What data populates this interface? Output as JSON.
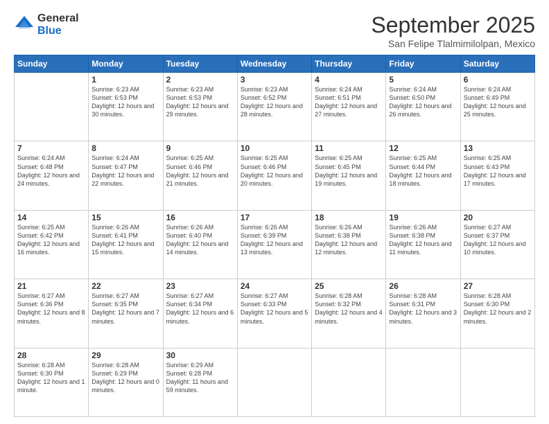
{
  "logo": {
    "general": "General",
    "blue": "Blue"
  },
  "header": {
    "month": "September 2025",
    "location": "San Felipe Tlalmimilolpan, Mexico"
  },
  "weekdays": [
    "Sunday",
    "Monday",
    "Tuesday",
    "Wednesday",
    "Thursday",
    "Friday",
    "Saturday"
  ],
  "weeks": [
    [
      {
        "day": "",
        "sunrise": "",
        "sunset": "",
        "daylight": ""
      },
      {
        "day": "1",
        "sunrise": "Sunrise: 6:23 AM",
        "sunset": "Sunset: 6:53 PM",
        "daylight": "Daylight: 12 hours and 30 minutes."
      },
      {
        "day": "2",
        "sunrise": "Sunrise: 6:23 AM",
        "sunset": "Sunset: 6:53 PM",
        "daylight": "Daylight: 12 hours and 29 minutes."
      },
      {
        "day": "3",
        "sunrise": "Sunrise: 6:23 AM",
        "sunset": "Sunset: 6:52 PM",
        "daylight": "Daylight: 12 hours and 28 minutes."
      },
      {
        "day": "4",
        "sunrise": "Sunrise: 6:24 AM",
        "sunset": "Sunset: 6:51 PM",
        "daylight": "Daylight: 12 hours and 27 minutes."
      },
      {
        "day": "5",
        "sunrise": "Sunrise: 6:24 AM",
        "sunset": "Sunset: 6:50 PM",
        "daylight": "Daylight: 12 hours and 26 minutes."
      },
      {
        "day": "6",
        "sunrise": "Sunrise: 6:24 AM",
        "sunset": "Sunset: 6:49 PM",
        "daylight": "Daylight: 12 hours and 25 minutes."
      }
    ],
    [
      {
        "day": "7",
        "sunrise": "Sunrise: 6:24 AM",
        "sunset": "Sunset: 6:48 PM",
        "daylight": "Daylight: 12 hours and 24 minutes."
      },
      {
        "day": "8",
        "sunrise": "Sunrise: 6:24 AM",
        "sunset": "Sunset: 6:47 PM",
        "daylight": "Daylight: 12 hours and 22 minutes."
      },
      {
        "day": "9",
        "sunrise": "Sunrise: 6:25 AM",
        "sunset": "Sunset: 6:46 PM",
        "daylight": "Daylight: 12 hours and 21 minutes."
      },
      {
        "day": "10",
        "sunrise": "Sunrise: 6:25 AM",
        "sunset": "Sunset: 6:46 PM",
        "daylight": "Daylight: 12 hours and 20 minutes."
      },
      {
        "day": "11",
        "sunrise": "Sunrise: 6:25 AM",
        "sunset": "Sunset: 6:45 PM",
        "daylight": "Daylight: 12 hours and 19 minutes."
      },
      {
        "day": "12",
        "sunrise": "Sunrise: 6:25 AM",
        "sunset": "Sunset: 6:44 PM",
        "daylight": "Daylight: 12 hours and 18 minutes."
      },
      {
        "day": "13",
        "sunrise": "Sunrise: 6:25 AM",
        "sunset": "Sunset: 6:43 PM",
        "daylight": "Daylight: 12 hours and 17 minutes."
      }
    ],
    [
      {
        "day": "14",
        "sunrise": "Sunrise: 6:25 AM",
        "sunset": "Sunset: 6:42 PM",
        "daylight": "Daylight: 12 hours and 16 minutes."
      },
      {
        "day": "15",
        "sunrise": "Sunrise: 6:26 AM",
        "sunset": "Sunset: 6:41 PM",
        "daylight": "Daylight: 12 hours and 15 minutes."
      },
      {
        "day": "16",
        "sunrise": "Sunrise: 6:26 AM",
        "sunset": "Sunset: 6:40 PM",
        "daylight": "Daylight: 12 hours and 14 minutes."
      },
      {
        "day": "17",
        "sunrise": "Sunrise: 6:26 AM",
        "sunset": "Sunset: 6:39 PM",
        "daylight": "Daylight: 12 hours and 13 minutes."
      },
      {
        "day": "18",
        "sunrise": "Sunrise: 6:26 AM",
        "sunset": "Sunset: 6:38 PM",
        "daylight": "Daylight: 12 hours and 12 minutes."
      },
      {
        "day": "19",
        "sunrise": "Sunrise: 6:26 AM",
        "sunset": "Sunset: 6:38 PM",
        "daylight": "Daylight: 12 hours and 11 minutes."
      },
      {
        "day": "20",
        "sunrise": "Sunrise: 6:27 AM",
        "sunset": "Sunset: 6:37 PM",
        "daylight": "Daylight: 12 hours and 10 minutes."
      }
    ],
    [
      {
        "day": "21",
        "sunrise": "Sunrise: 6:27 AM",
        "sunset": "Sunset: 6:36 PM",
        "daylight": "Daylight: 12 hours and 8 minutes."
      },
      {
        "day": "22",
        "sunrise": "Sunrise: 6:27 AM",
        "sunset": "Sunset: 6:35 PM",
        "daylight": "Daylight: 12 hours and 7 minutes."
      },
      {
        "day": "23",
        "sunrise": "Sunrise: 6:27 AM",
        "sunset": "Sunset: 6:34 PM",
        "daylight": "Daylight: 12 hours and 6 minutes."
      },
      {
        "day": "24",
        "sunrise": "Sunrise: 6:27 AM",
        "sunset": "Sunset: 6:33 PM",
        "daylight": "Daylight: 12 hours and 5 minutes."
      },
      {
        "day": "25",
        "sunrise": "Sunrise: 6:28 AM",
        "sunset": "Sunset: 6:32 PM",
        "daylight": "Daylight: 12 hours and 4 minutes."
      },
      {
        "day": "26",
        "sunrise": "Sunrise: 6:28 AM",
        "sunset": "Sunset: 6:31 PM",
        "daylight": "Daylight: 12 hours and 3 minutes."
      },
      {
        "day": "27",
        "sunrise": "Sunrise: 6:28 AM",
        "sunset": "Sunset: 6:30 PM",
        "daylight": "Daylight: 12 hours and 2 minutes."
      }
    ],
    [
      {
        "day": "28",
        "sunrise": "Sunrise: 6:28 AM",
        "sunset": "Sunset: 6:30 PM",
        "daylight": "Daylight: 12 hours and 1 minute."
      },
      {
        "day": "29",
        "sunrise": "Sunrise: 6:28 AM",
        "sunset": "Sunset: 6:29 PM",
        "daylight": "Daylight: 12 hours and 0 minutes."
      },
      {
        "day": "30",
        "sunrise": "Sunrise: 6:29 AM",
        "sunset": "Sunset: 6:28 PM",
        "daylight": "Daylight: 11 hours and 59 minutes."
      },
      {
        "day": "",
        "sunrise": "",
        "sunset": "",
        "daylight": ""
      },
      {
        "day": "",
        "sunrise": "",
        "sunset": "",
        "daylight": ""
      },
      {
        "day": "",
        "sunrise": "",
        "sunset": "",
        "daylight": ""
      },
      {
        "day": "",
        "sunrise": "",
        "sunset": "",
        "daylight": ""
      }
    ]
  ]
}
